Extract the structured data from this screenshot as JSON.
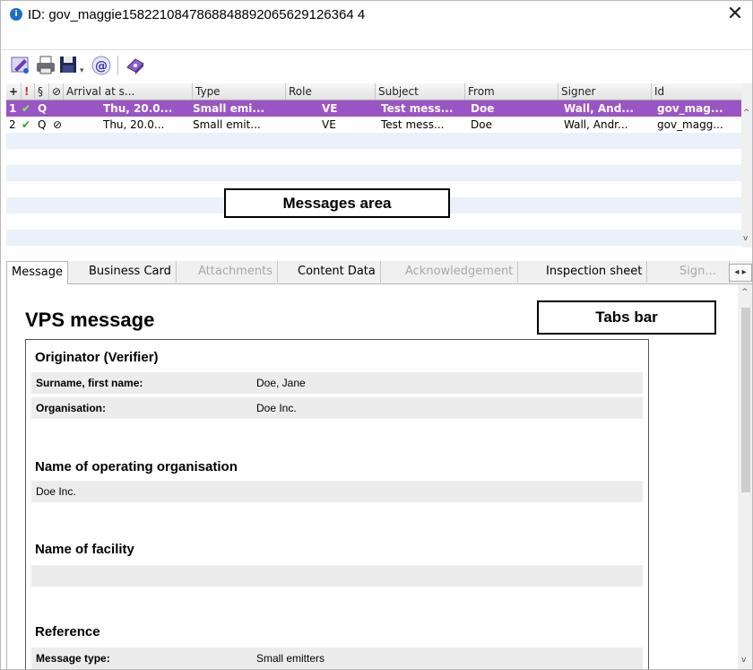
{
  "window": {
    "title": "ID: gov_maggie1582210847868848892065629126364 4",
    "close_symbol": "✕"
  },
  "toolbar": {
    "buttons": [
      "edit-stamp-icon",
      "print-icon",
      "save-icon",
      "email-icon",
      "help-book-icon"
    ],
    "save_dropdown": "▾"
  },
  "grid": {
    "headers": [
      "+",
      "!",
      "§",
      "⊘",
      "Arrival at s...",
      "Type",
      "Role",
      "Subject",
      "From",
      "Signer",
      "Id"
    ],
    "rows": [
      {
        "num": "1",
        "check": "✔",
        "q": "Q",
        "clip": "",
        "arrival": "Thu, 20.0...",
        "type": "Small emi...",
        "role": "VE",
        "subject": "Test mess...",
        "from": "Doe",
        "signer": "Wall, And...",
        "id": "gov_mag..."
      },
      {
        "num": "2",
        "check": "✔",
        "q": "Q",
        "clip": "⊘",
        "arrival": "Thu, 20.0...",
        "type": "Small emit...",
        "role": "VE",
        "subject": "Test mess...",
        "from": "Doe",
        "signer": "Wall, Andr...",
        "id": "gov_magg..."
      }
    ]
  },
  "callouts": {
    "messages_area": "Messages area",
    "tabs_bar": "Tabs bar"
  },
  "tabs": [
    {
      "label": "Message",
      "state": "active"
    },
    {
      "label": "Business Card",
      "state": "enabled"
    },
    {
      "label": "Attachments",
      "state": "disabled"
    },
    {
      "label": "Content Data",
      "state": "enabled"
    },
    {
      "label": "Acknowledgement",
      "state": "disabled"
    },
    {
      "label": "Inspection sheet",
      "state": "enabled"
    },
    {
      "label": "Sign...",
      "state": "disabled"
    }
  ],
  "content": {
    "title": "VPS message",
    "originator_heading": "Originator (Verifier)",
    "surname_label": "Surname, first name:",
    "surname_value": "Doe, Jane",
    "organisation_label": "Organisation:",
    "organisation_value": "Doe Inc.",
    "operating_org_heading": "Name of operating organisation",
    "operating_org_value": "Doe Inc.",
    "facility_heading": "Name of facility",
    "facility_value": "",
    "reference_heading": "Reference",
    "message_type_label": "Message type:",
    "message_type_value": "Small emitters"
  },
  "colors": {
    "selected_row": "#9a55c4",
    "alt_row": "#eaf1fb",
    "check_green": "#2aa12a",
    "field_bg": "#ececec"
  }
}
